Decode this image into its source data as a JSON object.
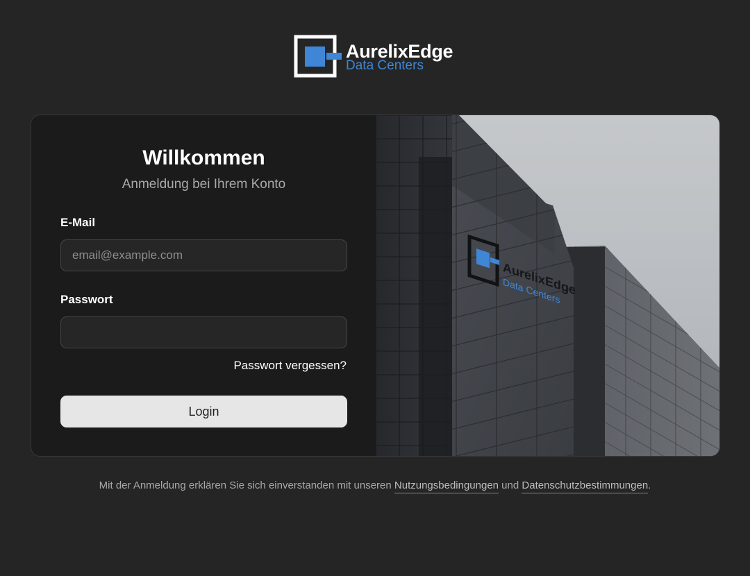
{
  "brand": {
    "name": "AurelixEdge",
    "subtitle": "Data Centers",
    "accent_color": "#3f86d6"
  },
  "login": {
    "title": "Willkommen",
    "subtitle": "Anmeldung bei Ihrem Konto",
    "email_label": "E-Mail",
    "email_placeholder": "email@example.com",
    "email_value": "",
    "password_label": "Passwort",
    "password_value": "",
    "forgot_link": "Passwort vergessen?",
    "login_button": "Login"
  },
  "hero_image": {
    "sign_name": "AurelixEdge",
    "sign_subtitle": "Data Centers"
  },
  "footer": {
    "text_before": "Mit der Anmeldung erklären Sie sich einverstanden mit unseren ",
    "terms_link": "Nutzungsbedingungen",
    "text_middle": " und ",
    "privacy_link": "Datenschutzbestimmungen",
    "text_after": "."
  }
}
